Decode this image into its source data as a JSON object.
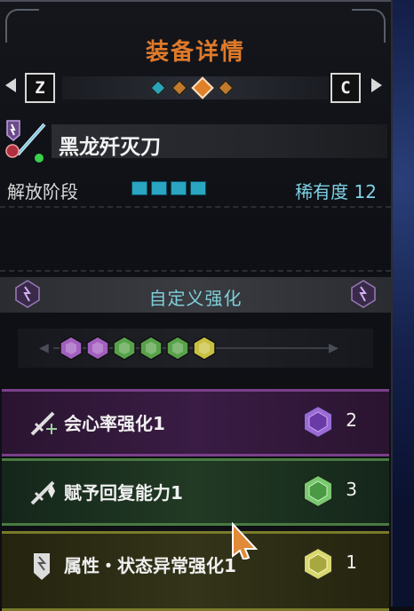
{
  "header": {
    "title": "装备详情"
  },
  "nav": {
    "left_key": "Z",
    "right_key": "C",
    "dots": [
      {
        "color": "#2aa5b8",
        "size": "small"
      },
      {
        "color": "#c07a2a",
        "size": "small"
      },
      {
        "color": "#e0802a",
        "size": "big"
      },
      {
        "color": "#c07a2a",
        "size": "small"
      }
    ]
  },
  "weapon": {
    "name": "黑龙歼灭刀"
  },
  "stage": {
    "label": "解放阶段",
    "filled": 4,
    "rarity_label": "稀有度 12"
  },
  "custom": {
    "title": "自定义强化"
  },
  "slots": [
    {
      "color": "#a25fc0"
    },
    {
      "color": "#a25fc0"
    },
    {
      "color": "#58a24a"
    },
    {
      "color": "#58a24a"
    },
    {
      "color": "#58a24a"
    },
    {
      "color": "#c8c040"
    }
  ],
  "augments": [
    {
      "label": "会心率强化1",
      "count": "2",
      "gem_color": "#9a6ad6",
      "icon": "sword-crit-icon"
    },
    {
      "label": "赋予回复能力1",
      "count": "3",
      "gem_color": "#7ac870",
      "icon": "sword-heal-icon"
    },
    {
      "label": "属性・状态异常强化1",
      "count": "1",
      "gem_color": "#d8d870",
      "icon": "element-icon"
    }
  ],
  "colors": {
    "accent_orange": "#e07a2a",
    "cyan": "#7fd2e6"
  }
}
